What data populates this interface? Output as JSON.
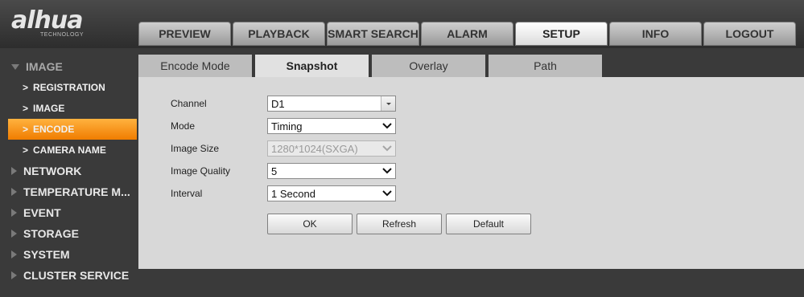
{
  "logo": {
    "main": "alhua",
    "sub": "TECHNOLOGY"
  },
  "top_nav": [
    {
      "label": "PREVIEW",
      "active": false
    },
    {
      "label": "PLAYBACK",
      "active": false
    },
    {
      "label": "SMART SEARCH",
      "active": false
    },
    {
      "label": "ALARM",
      "active": false
    },
    {
      "label": "SETUP",
      "active": true
    },
    {
      "label": "INFO",
      "active": false
    },
    {
      "label": "LOGOUT",
      "active": false
    }
  ],
  "sidebar": {
    "image_section": "IMAGE",
    "image_subitems": [
      "REGISTRATION",
      "IMAGE",
      "ENCODE",
      "CAMERA NAME"
    ],
    "selected_subitem": "ENCODE",
    "sections": [
      "NETWORK",
      "TEMPERATURE M...",
      "EVENT",
      "STORAGE",
      "SYSTEM",
      "CLUSTER SERVICE"
    ]
  },
  "sub_tabs": [
    {
      "label": "Encode Mode",
      "active": false
    },
    {
      "label": "Snapshot",
      "active": true
    },
    {
      "label": "Overlay",
      "active": false
    },
    {
      "label": "Path",
      "active": false
    }
  ],
  "form": {
    "channel": {
      "label": "Channel",
      "value": "D1"
    },
    "mode": {
      "label": "Mode",
      "value": "Timing"
    },
    "image_size": {
      "label": "Image Size",
      "value": "1280*1024(SXGA)"
    },
    "image_quality": {
      "label": "Image Quality",
      "value": "5"
    },
    "interval": {
      "label": "Interval",
      "value": "1 Second"
    }
  },
  "buttons": {
    "ok": "OK",
    "refresh": "Refresh",
    "default": "Default"
  },
  "colors": {
    "accent": "#f5901a",
    "panel": "#d8d8d8",
    "background": "#3a3a3a"
  }
}
